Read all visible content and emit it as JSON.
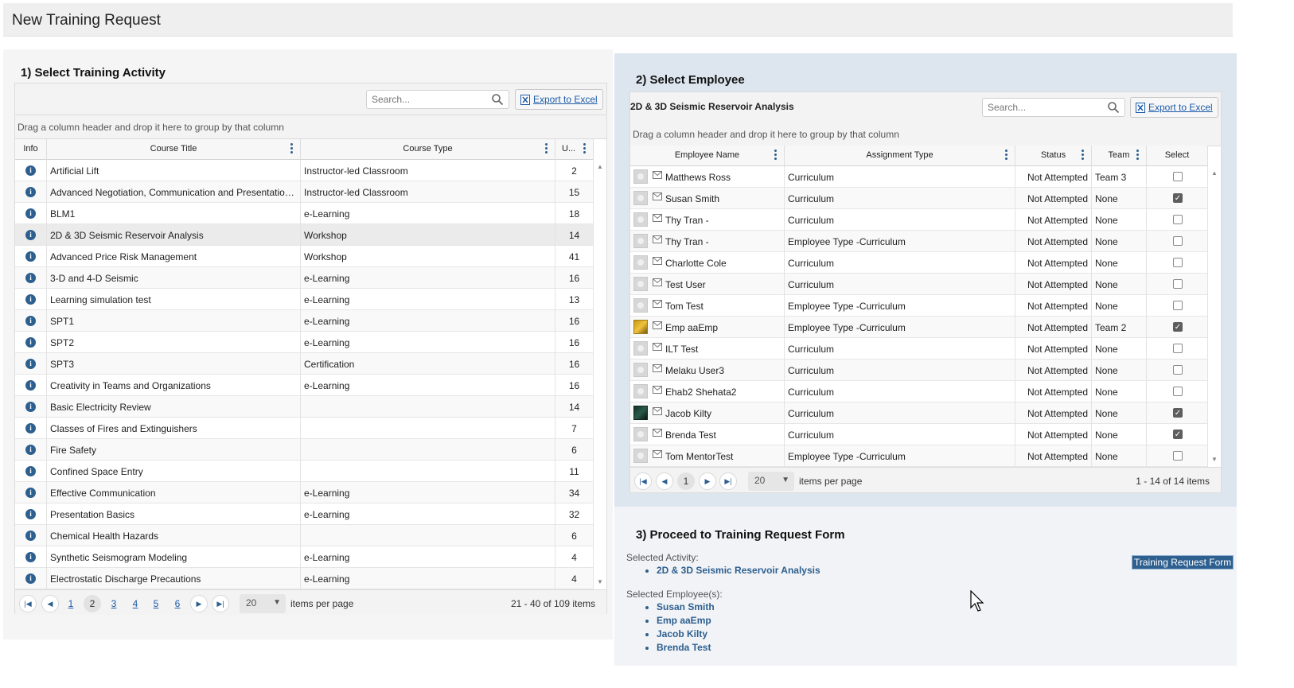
{
  "page": {
    "title": "New Training Request"
  },
  "activity_panel": {
    "title": "1) Select Training Activity",
    "search_placeholder": "Search...",
    "export_label": "Export to Excel",
    "group_hint": "Drag a column header and drop it here to group by that column",
    "columns": [
      "Info",
      "Course Title",
      "Course Type",
      "U..."
    ],
    "rows": [
      {
        "title": "Artificial Lift",
        "type": "Instructor-led Classroom",
        "u": "2"
      },
      {
        "title": "Advanced Negotiation, Communication and Presentation ...",
        "type": "Instructor-led Classroom",
        "u": "15"
      },
      {
        "title": "BLM1",
        "type": "e-Learning",
        "u": "18"
      },
      {
        "title": "2D & 3D Seismic Reservoir Analysis",
        "type": "Workshop",
        "u": "14"
      },
      {
        "title": "Advanced Price Risk Management",
        "type": "Workshop",
        "u": "41"
      },
      {
        "title": "3-D and 4-D Seismic",
        "type": "e-Learning",
        "u": "16"
      },
      {
        "title": "Learning simulation test",
        "type": "e-Learning",
        "u": "13"
      },
      {
        "title": "SPT1",
        "type": "e-Learning",
        "u": "16"
      },
      {
        "title": "SPT2",
        "type": "e-Learning",
        "u": "16"
      },
      {
        "title": "SPT3",
        "type": "Certification",
        "u": "16"
      },
      {
        "title": "Creativity in Teams and Organizations",
        "type": "e-Learning",
        "u": "16"
      },
      {
        "title": "Basic Electricity Review",
        "type": "",
        "u": "14"
      },
      {
        "title": "Classes of Fires and Extinguishers",
        "type": "",
        "u": "7"
      },
      {
        "title": "Fire Safety",
        "type": "",
        "u": "6"
      },
      {
        "title": "Confined Space Entry",
        "type": "",
        "u": "11"
      },
      {
        "title": "Effective Communication",
        "type": "e-Learning",
        "u": "34"
      },
      {
        "title": "Presentation Basics",
        "type": "e-Learning",
        "u": "32"
      },
      {
        "title": "Chemical Health Hazards",
        "type": "",
        "u": "6"
      },
      {
        "title": "Synthetic Seismogram Modeling",
        "type": "e-Learning",
        "u": "4"
      },
      {
        "title": "Electrostatic Discharge Precautions",
        "type": "e-Learning",
        "u": "4"
      }
    ],
    "pager": {
      "pages": [
        "1",
        "2",
        "3",
        "4",
        "5",
        "6"
      ],
      "current": "2",
      "page_size": "20",
      "items_per_page_label": "items per page",
      "info": "21 - 40 of 109 items"
    }
  },
  "employee_panel": {
    "title": "2) Select Employee",
    "activity_title": "2D & 3D Seismic Reservoir Analysis",
    "search_placeholder": "Search...",
    "export_label": "Export to Excel",
    "group_hint": "Drag a column header and drop it here to group by that column",
    "columns": [
      "Employee Name",
      "Assignment Type",
      "Status",
      "Team",
      "Select"
    ],
    "rows": [
      {
        "name": "Matthews Ross",
        "assignment": "Curriculum",
        "status": "Not Attempted",
        "team": "Team 3",
        "selected": false,
        "avatar": "default"
      },
      {
        "name": "Susan Smith",
        "assignment": "Curriculum",
        "status": "Not Attempted",
        "team": "None",
        "selected": true,
        "avatar": "default"
      },
      {
        "name": "Thy Tran -",
        "assignment": "Curriculum",
        "status": "Not Attempted",
        "team": "None",
        "selected": false,
        "avatar": "default"
      },
      {
        "name": "Thy Tran -",
        "assignment": "Employee Type -Curriculum",
        "status": "Not Attempted",
        "team": "None",
        "selected": false,
        "avatar": "default"
      },
      {
        "name": "Charlotte Cole",
        "assignment": "Curriculum",
        "status": "Not Attempted",
        "team": "None",
        "selected": false,
        "avatar": "default"
      },
      {
        "name": "Test User",
        "assignment": "Curriculum",
        "status": "Not Attempted",
        "team": "None",
        "selected": false,
        "avatar": "default"
      },
      {
        "name": "Tom Test",
        "assignment": "Employee Type -Curriculum",
        "status": "Not Attempted",
        "team": "None",
        "selected": false,
        "avatar": "default"
      },
      {
        "name": "Emp aaEmp",
        "assignment": "Employee Type -Curriculum",
        "status": "Not Attempted",
        "team": "Team 2",
        "selected": true,
        "avatar": "photo1"
      },
      {
        "name": "ILT Test",
        "assignment": "Curriculum",
        "status": "Not Attempted",
        "team": "None",
        "selected": false,
        "avatar": "default"
      },
      {
        "name": "Melaku User3",
        "assignment": "Curriculum",
        "status": "Not Attempted",
        "team": "None",
        "selected": false,
        "avatar": "default"
      },
      {
        "name": "Ehab2 Shehata2",
        "assignment": "Curriculum",
        "status": "Not Attempted",
        "team": "None",
        "selected": false,
        "avatar": "default"
      },
      {
        "name": "Jacob Kilty",
        "assignment": "Curriculum",
        "status": "Not Attempted",
        "team": "None",
        "selected": true,
        "avatar": "photo2"
      },
      {
        "name": "Brenda Test",
        "assignment": "Curriculum",
        "status": "Not Attempted",
        "team": "None",
        "selected": true,
        "avatar": "default"
      },
      {
        "name": "Tom MentorTest",
        "assignment": "Employee Type -Curriculum",
        "status": "Not Attempted",
        "team": "None",
        "selected": false,
        "avatar": "default"
      }
    ],
    "pager": {
      "pages": [
        "1"
      ],
      "current": "1",
      "page_size": "20",
      "items_per_page_label": "items per page",
      "info": "1 - 14 of 14 items"
    }
  },
  "proceed_panel": {
    "title": "3) Proceed to Training Request Form",
    "selected_activity_label": "Selected Activity:",
    "selected_activity": [
      "2D & 3D Seismic Reservoir Analysis"
    ],
    "selected_employees_label": "Selected Employee(s):",
    "selected_employees": [
      "Susan Smith",
      "Emp aaEmp",
      "Jacob Kilty",
      "Brenda Test"
    ],
    "form_button": "Training Request Form"
  },
  "colors": {
    "accent": "#2d5f8f",
    "link": "#1d5ba8",
    "employee_panel_bg": "#dde5ee"
  },
  "icons": [
    "search-icon",
    "excel-icon",
    "info-icon",
    "mail-icon",
    "more-vertical-icon",
    "first-page-icon",
    "prev-page-icon",
    "next-page-icon",
    "last-page-icon",
    "cursor-icon"
  ]
}
